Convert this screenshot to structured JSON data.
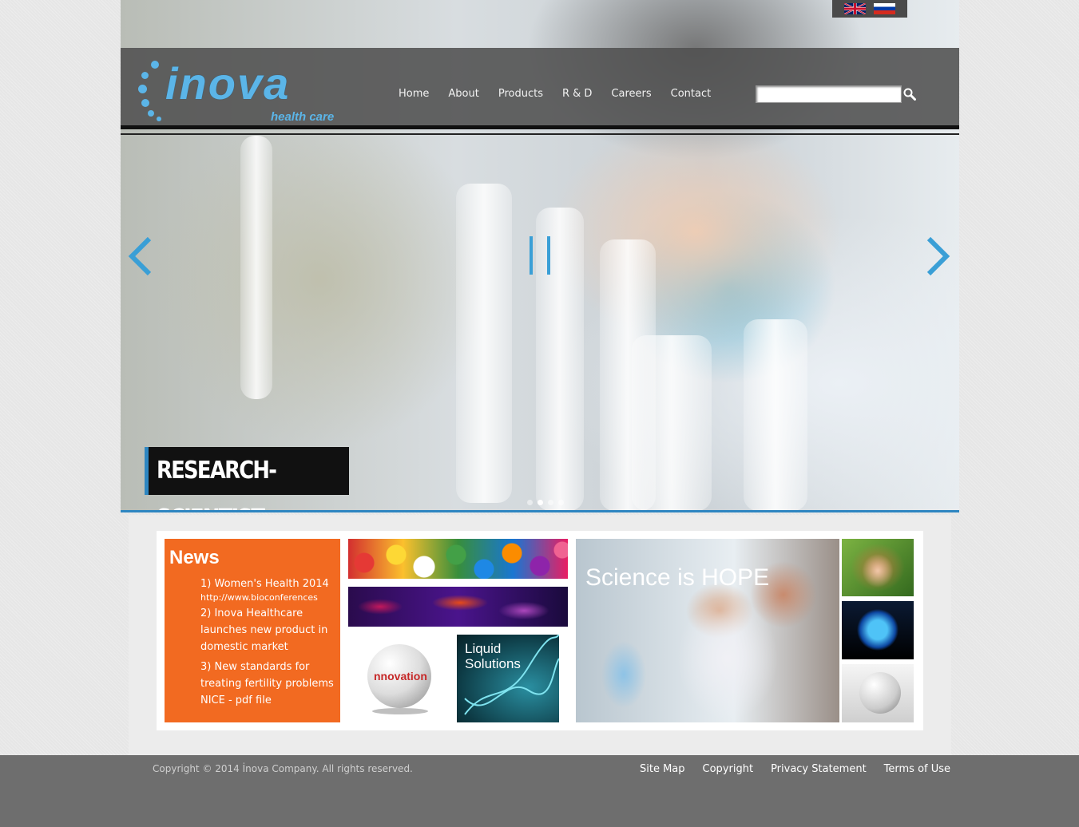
{
  "brand": {
    "name": "inova",
    "tagline": "health care",
    "accent_color": "#2e86c1",
    "news_color": "#f26a21"
  },
  "language_switcher": {
    "languages": [
      "English",
      "Russian"
    ]
  },
  "nav": {
    "items": [
      "Home",
      "About",
      "Products",
      "R & D",
      "Careers",
      "Contact"
    ]
  },
  "search": {
    "value": "",
    "icon": "search-icon"
  },
  "slider": {
    "caption": "RESEARCH-SCIENTIST",
    "total_slides": 4,
    "active_slide": 2,
    "controls": [
      "prev-arrow-icon",
      "pause-icon",
      "next-arrow-icon"
    ]
  },
  "news": {
    "title": "News",
    "items": [
      {
        "text": "1) Women's Health 2014",
        "link": "http://www.bioconferences"
      },
      {
        "text": "2) Inova Healthcare launches new product in domestic market"
      },
      {
        "text": "3) New standards for treating fertility problems NICE - pdf file"
      }
    ]
  },
  "tiles": {
    "liquid": "Liquid Solutions",
    "innovation": "nnovation",
    "science": "Science is HOPE"
  },
  "footer": {
    "copyright": "Copyright © 2014 İnova Company. All rights reserved.",
    "links": [
      "Site Map",
      "Copyright",
      "Privacy Statement",
      "Terms of Use"
    ]
  }
}
